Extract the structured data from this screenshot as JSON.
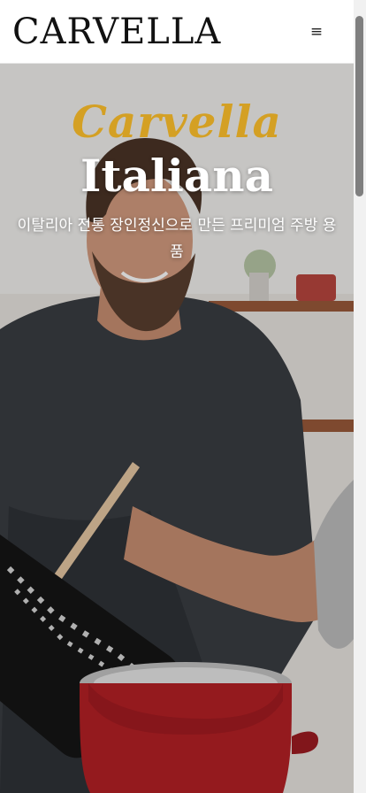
{
  "header": {
    "logo_text": "CARVELLA",
    "menu_icon": "hamburger-menu-icon",
    "menu_glyph": "≡"
  },
  "hero": {
    "title_line1": "Carvella",
    "title_line2": "Italiana",
    "description": "이탈리아 전통 장인정신으로 만든 프리미엄 주방 용품",
    "accent_color": "#d4a024"
  }
}
